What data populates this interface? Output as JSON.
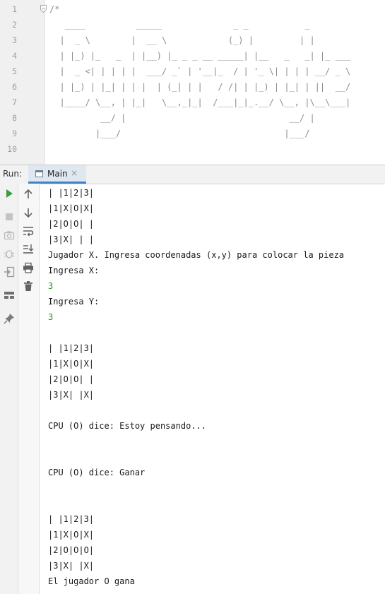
{
  "editor": {
    "line_numbers": [
      "1",
      "2",
      "3",
      "4",
      "5",
      "6",
      "7",
      "8",
      "9",
      "10"
    ],
    "code_lines": [
      "/*",
      "   ____          _____              _ _           _",
      "  |  _ \\        |  __ \\            (_) |         | |",
      "  | |_) |_   _  | |__) |_ _ _ __ _____| |__   _   _| |_ ___",
      "  |  _ <| | | | |  ___/ _` | '__|_  / | '_ \\| | | | __/ _ \\",
      "  | |_) | |_| | | |  | (_| | |   / /| | |_) | |_| | ||  __/",
      "  |____/ \\__, | |_|   \\__,_|_|  /___|_|_.__/ \\__, |\\__\\___|",
      "          __/ |                                __/ |",
      "         |___/                                |___/",
      ""
    ]
  },
  "run_panel": {
    "label": "Run:",
    "tab_label": "Main",
    "tab_close": "×"
  },
  "toolbar_icons": {
    "left": [
      "play-icon",
      "stop-icon",
      "camera-icon",
      "debug-icon",
      "exit-icon",
      "layout-icon",
      "pin-icon"
    ],
    "second": [
      "arrow-up-icon",
      "arrow-down-icon",
      "soft-wrap-icon",
      "scroll-to-end-icon",
      "print-icon",
      "trash-icon"
    ]
  },
  "console": {
    "lines": [
      {
        "text": "| |1|2|3|",
        "input": false
      },
      {
        "text": "|1|X|O|X|",
        "input": false
      },
      {
        "text": "|2|O|O| |",
        "input": false
      },
      {
        "text": "|3|X| | |",
        "input": false
      },
      {
        "text": "Jugador X. Ingresa coordenadas (x,y) para colocar la pieza",
        "input": false
      },
      {
        "text": "Ingresa X:",
        "input": false
      },
      {
        "text": "3",
        "input": true
      },
      {
        "text": "Ingresa Y:",
        "input": false
      },
      {
        "text": "3",
        "input": true
      },
      {
        "text": "",
        "input": false
      },
      {
        "text": "| |1|2|3|",
        "input": false
      },
      {
        "text": "|1|X|O|X|",
        "input": false
      },
      {
        "text": "|2|O|O| |",
        "input": false
      },
      {
        "text": "|3|X| |X|",
        "input": false
      },
      {
        "text": "",
        "input": false
      },
      {
        "text": "CPU (O) dice: Estoy pensando...",
        "input": false
      },
      {
        "text": "",
        "input": false
      },
      {
        "text": "",
        "input": false
      },
      {
        "text": "CPU (O) dice: Ganar",
        "input": false
      },
      {
        "text": "",
        "input": false
      },
      {
        "text": "",
        "input": false
      },
      {
        "text": "| |1|2|3|",
        "input": false
      },
      {
        "text": "|1|X|O|X|",
        "input": false
      },
      {
        "text": "|2|O|O|O|",
        "input": false
      },
      {
        "text": "|3|X| |X|",
        "input": false
      },
      {
        "text": "El jugador O gana",
        "input": false
      }
    ]
  },
  "colors": {
    "accent": "#4083c9",
    "input_text": "#2a8a2a",
    "comment_text": "#8c8c8c",
    "run_green": "#3c9a3c"
  }
}
